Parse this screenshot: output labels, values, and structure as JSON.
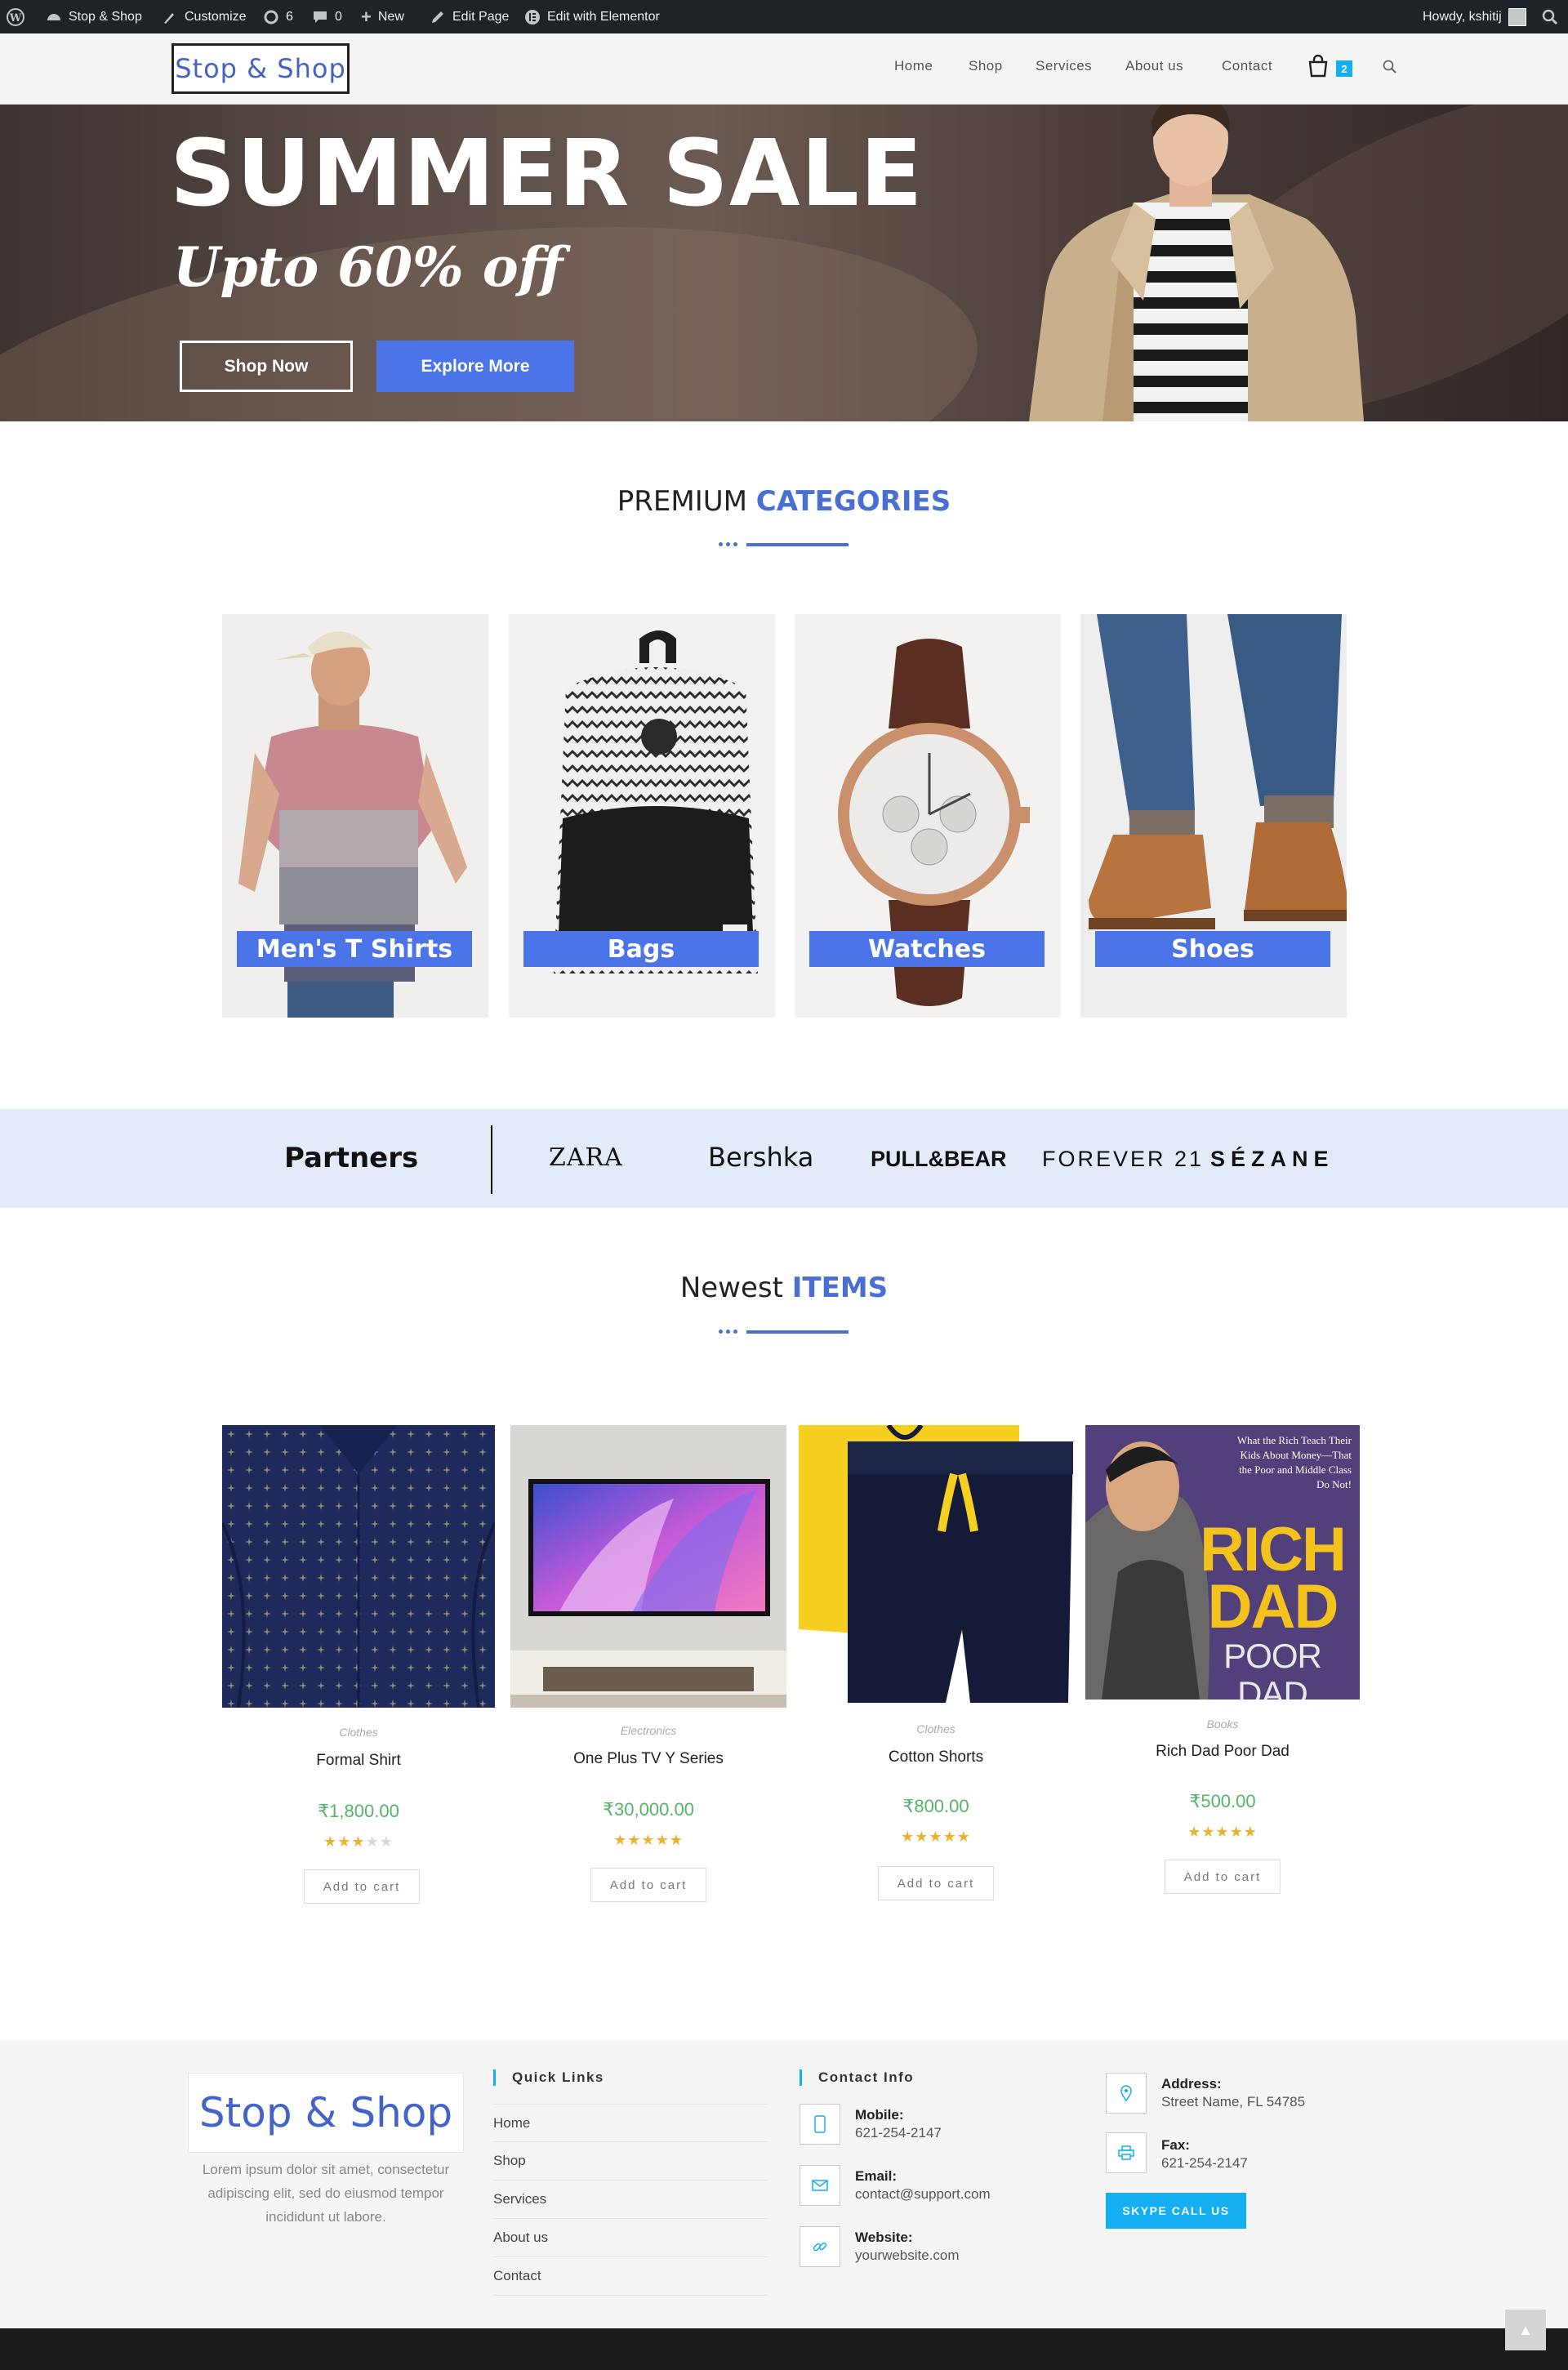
{
  "admin_bar": {
    "site_name": "Stop & Shop",
    "customize": "Customize",
    "updates_count": "6",
    "comments_count": "0",
    "new_label": "New",
    "edit_page": "Edit Page",
    "edit_elementor": "Edit with Elementor",
    "howdy": "Howdy, kshitij"
  },
  "header": {
    "logo_text": "Stop & Shop",
    "nav": [
      "Home",
      "Shop",
      "Services",
      "About us",
      "Contact"
    ],
    "cart_count": "2"
  },
  "hero": {
    "title": "SUMMER SALE",
    "subtitle": "Upto 60% off",
    "shop_now": "Shop Now",
    "explore_more": "Explore More"
  },
  "categories": {
    "heading_plain": "PREMIUM",
    "heading_accent": "CATEGORIES",
    "items": [
      "Men's T Shirts",
      "Bags",
      "Watches",
      "Shoes"
    ]
  },
  "partners": {
    "title": "Partners",
    "brands": [
      "ZARA",
      "Bershka",
      "PULL&BEAR",
      "FOREVER 21",
      "SÉZANE"
    ]
  },
  "newest": {
    "heading_plain": "Newest",
    "heading_accent": "ITEMS",
    "add_to_cart": "Add to cart",
    "products": [
      {
        "category": "Clothes",
        "name": "Formal Shirt",
        "price": "₹1,800.00",
        "rating": 3
      },
      {
        "category": "Electronics",
        "name": "One Plus TV Y Series",
        "price": "₹30,000.00",
        "rating": 5
      },
      {
        "category": "Clothes",
        "name": "Cotton Shorts",
        "price": "₹800.00",
        "rating": 5
      },
      {
        "category": "Books",
        "name": "Rich Dad Poor Dad",
        "price": "₹500.00",
        "rating": 5
      }
    ],
    "book_cover": {
      "tagline": "What the Rich Teach Their Kids About Money—That the Poor and Middle Class Do Not!",
      "line1": "RICH",
      "line2": "DAD",
      "line3": "POOR DAD"
    }
  },
  "footer": {
    "logo_text": "Stop & Shop",
    "about": "Lorem ipsum dolor sit amet, consectetur adipiscing elit, sed do eiusmod tempor incididunt ut labore.",
    "quick_links_title": "Quick Links",
    "quick_links": [
      "Home",
      "Shop",
      "Services",
      "About us",
      "Contact"
    ],
    "contact_title": "Contact Info",
    "mobile_label": "Mobile:",
    "mobile": "621-254-2147",
    "email_label": "Email:",
    "email": "contact@support.com",
    "website_label": "Website:",
    "website": "yourwebsite.com",
    "address_label": "Address:",
    "address": "Street Name, FL 54785",
    "fax_label": "Fax:",
    "fax": "621-254-2147",
    "skype": "SKYPE CALL US"
  },
  "colors": {
    "accent_blue": "#4a6fd4",
    "button_blue": "#4a74e8",
    "footer_cyan": "#13aff0",
    "price_green": "#56b36a",
    "star_gold": "#e9b32d"
  }
}
